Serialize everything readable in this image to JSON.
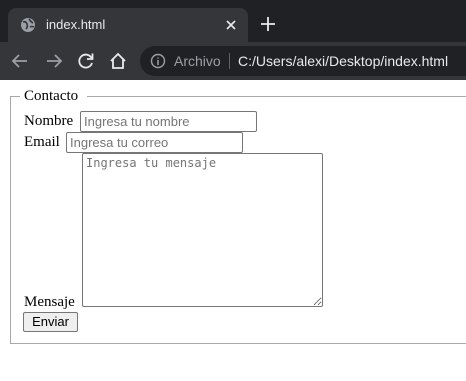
{
  "browser": {
    "tab_title": "index.html",
    "close_glyph": "✕",
    "omnibox": {
      "scheme_label": "Archivo",
      "url": "C:/Users/alexi/Desktop/index.html"
    },
    "icons": [
      "globe-icon",
      "close-icon",
      "new-tab-icon",
      "back-icon",
      "forward-icon",
      "reload-icon",
      "home-icon",
      "info-icon"
    ]
  },
  "form": {
    "legend": "Contacto",
    "nombre": {
      "label": "Nombre",
      "placeholder": "Ingresa tu nombre",
      "value": ""
    },
    "email": {
      "label": "Email",
      "placeholder": "Ingresa tu correo",
      "value": ""
    },
    "mensaje": {
      "label": "Mensaje",
      "placeholder": "Ingresa tu mensaje",
      "value": ""
    },
    "submit_label": "Enviar"
  },
  "colors": {
    "chrome_dark": "#202124",
    "chrome_tab": "#35363a",
    "chrome_text": "#e8eaed",
    "chrome_muted": "#9aa0a6",
    "fieldset_border": "#a9a9a9"
  }
}
